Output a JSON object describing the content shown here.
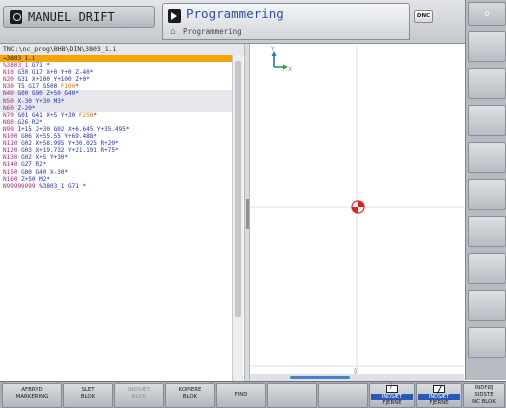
{
  "header": {
    "mode_label": "MANUEL DRIFT",
    "program_title": "Programmering",
    "program_subtitle": "Programmering",
    "dnc_label": "DNC",
    "right_top_number": "0"
  },
  "program": {
    "path": "TNC:\\nc_prog\\BHB\\DIN\\3803_1.i",
    "lines": [
      {
        "text": "→3803_1.i",
        "style": "hl"
      },
      {
        "text": "%3803_1 G71 *",
        "style": ""
      },
      {
        "text": "N10 G30 G17 X+0 Y+0 Z-40*",
        "style": ""
      },
      {
        "text": "N20 G31 X+100 Y+100 Z+0*",
        "style": ""
      },
      {
        "text": "N30 T5 G17 S500 F100*",
        "style": ""
      },
      {
        "text": "N40 G00 G90 Z+50 G40*",
        "style": "shade"
      },
      {
        "text": "N50 X-30 Y+30 M3*",
        "style": "shade"
      },
      {
        "text": "N60 Z-20*",
        "style": "shade"
      },
      {
        "text": "N70 G01 G41 X+5 Y+30 F250*",
        "style": ""
      },
      {
        "text": "N80 G26 R2*",
        "style": ""
      },
      {
        "text": "N90 I+15 J+30 G02 X+6.645 Y+35.495*",
        "style": ""
      },
      {
        "text": "N100 G06 X+55.55 Y+69.488*",
        "style": ""
      },
      {
        "text": "N110 G02 X+58.995 Y+30.025 R+20*",
        "style": ""
      },
      {
        "text": "N120 G03 X+19.732 Y+21.191 R+75*",
        "style": ""
      },
      {
        "text": "N130 G02 X+5 Y+30*",
        "style": ""
      },
      {
        "text": "N140 G27 R2*",
        "style": ""
      },
      {
        "text": "N150 G00 G40 X-30*",
        "style": ""
      },
      {
        "text": "N160 Z+50 M2*",
        "style": ""
      },
      {
        "text": "N99999999 %3803_1 G71 *",
        "style": ""
      }
    ]
  },
  "graphics": {
    "axis_y": "Y",
    "axis_x": "X",
    "axis_y_color": "#2a6fd6",
    "axis_x_color": "#25a33a",
    "crosshair_color": "#e02020"
  },
  "softkeys": {
    "afbryd": {
      "line1": "AFBRYD",
      "line2": "MARKERING"
    },
    "slet": {
      "line1": "SLET",
      "line2": "BLOK"
    },
    "indsaet_blok": {
      "line1": "INDSÆT",
      "line2": "BLOK"
    },
    "kopiere": {
      "line1": "KOPIERE",
      "line2": "BLOK"
    },
    "find": {
      "line1": "FIND"
    },
    "indsaet_fjerne_1": {
      "line1": "INDSÆT",
      "line2": "FJERNE"
    },
    "indsaet_fjerne_2": {
      "line1": "INDSÆT",
      "line2": "FJERNE"
    },
    "indfoj": {
      "line1": "INDFØJ",
      "line2": "SIDSTE",
      "line3": "NC BLOK"
    }
  }
}
